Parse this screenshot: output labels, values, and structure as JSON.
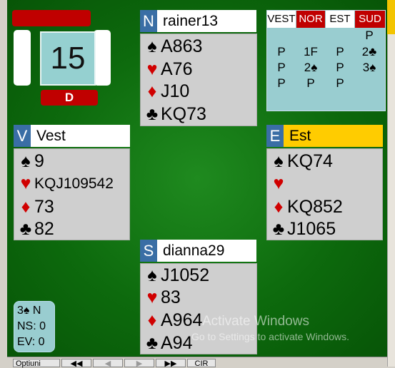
{
  "board": {
    "number": "15",
    "dealer": "D"
  },
  "north": {
    "seat": "N",
    "name": "rainer13",
    "suits": [
      {
        "sym": "♠",
        "cards": "A863",
        "red": false
      },
      {
        "sym": "♥",
        "cards": "A76",
        "red": true
      },
      {
        "sym": "♦",
        "cards": "J10",
        "red": true
      },
      {
        "sym": "♣",
        "cards": "KQ73",
        "red": false
      }
    ]
  },
  "west": {
    "seat": "V",
    "name": "Vest",
    "suits": [
      {
        "sym": "♠",
        "cards": "9",
        "red": false
      },
      {
        "sym": "♥",
        "cards": "KQJ109542",
        "red": true
      },
      {
        "sym": "♦",
        "cards": "73",
        "red": true
      },
      {
        "sym": "♣",
        "cards": "82",
        "red": false
      }
    ]
  },
  "east": {
    "seat": "E",
    "name": "Est",
    "suits": [
      {
        "sym": "♠",
        "cards": "KQ74",
        "red": false
      },
      {
        "sym": "♥",
        "cards": "",
        "red": true
      },
      {
        "sym": "♦",
        "cards": "KQ852",
        "red": true
      },
      {
        "sym": "♣",
        "cards": "J1065",
        "red": false
      }
    ]
  },
  "south": {
    "seat": "S",
    "name": "dianna29",
    "suits": [
      {
        "sym": "♠",
        "cards": "J1052",
        "red": false
      },
      {
        "sym": "♥",
        "cards": "83",
        "red": true
      },
      {
        "sym": "♦",
        "cards": "A964",
        "red": true
      },
      {
        "sym": "♣",
        "cards": "A94",
        "red": false
      }
    ]
  },
  "bidding": {
    "headers": [
      "VEST",
      "NOR",
      "EST",
      "SUD"
    ],
    "rows": [
      [
        "",
        "",
        "",
        "P"
      ],
      [
        "P",
        "1F",
        "P",
        "2♣"
      ],
      [
        "P",
        "2♠",
        "P",
        "3♠"
      ],
      [
        "P",
        "P",
        "P",
        ""
      ]
    ]
  },
  "score": {
    "contract": "3♠ N",
    "ns": "NS: 0",
    "ev": "EV: 0"
  },
  "bottom": {
    "options": "Optiuni",
    "first": "◀◀",
    "prev": "◀",
    "next": "▶",
    "last": "▶▶",
    "clear": "CIR"
  },
  "watermark": {
    "line1": "Activate Windows",
    "line2": "Go to Settings to activate Windows."
  },
  "colors": {
    "felt": "#0d6a0d",
    "seat_badge": "#3a6ea5",
    "east_header": "#ffcc00",
    "vul_red": "#c00000",
    "bid_panel": "#99cdd0"
  }
}
